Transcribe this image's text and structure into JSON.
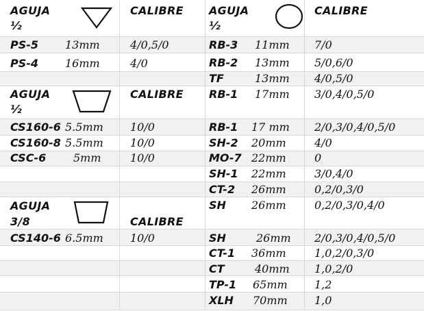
{
  "colors": {
    "band": "#f1f1f1",
    "grid": "#d8d8d8",
    "text": "#111111"
  },
  "headers": {
    "left_top": {
      "aguja": "AGUJA",
      "size": "½",
      "calibre": "CALIBRE",
      "shape_icon": "triangle-icon"
    },
    "right_top": {
      "aguja": "AGUJA",
      "size": "½",
      "calibre": "CALIBRE",
      "shape_icon": "circle-icon"
    },
    "left_mid": {
      "aguja": "AGUJA",
      "size": "½",
      "calibre": "CALIBRE",
      "shape_icon": "trapezoid-icon"
    },
    "left_low": {
      "aguja": "AGUJA",
      "size": "3/8",
      "calibre": "CALIBRE",
      "shape_icon": "trapezoid-icon"
    }
  },
  "left_rows": [
    {
      "code": "PS-5",
      "mm": "13mm",
      "calibre": "4/0,5/0"
    },
    {
      "code": "PS-4",
      "mm": "16mm",
      "calibre": "4/0"
    },
    {
      "code": "CS160-6",
      "mm": "5.5mm",
      "calibre": "10/0"
    },
    {
      "code": "CS160-8",
      "mm": "5.5mm",
      "calibre": "10/0"
    },
    {
      "code": "CSC-6",
      "mm": "5mm",
      "calibre": "10/0"
    },
    {
      "code": "CS140-6",
      "mm": "6.5mm",
      "calibre": "10/0"
    }
  ],
  "right_rows": [
    {
      "code": "RB-3",
      "mm": "11mm",
      "calibre": "7/0"
    },
    {
      "code": "RB-2",
      "mm": "13mm",
      "calibre": "5/0,6/0"
    },
    {
      "code": "TF",
      "mm": "13mm",
      "calibre": "4/0,5/0"
    },
    {
      "code": "RB-1",
      "mm": "17mm",
      "calibre": "3/0,4/0,5/0"
    },
    {
      "code": "RB-1",
      "mm": "17 mm",
      "calibre": "2/0,3/0,4/0,5/0"
    },
    {
      "code": "SH-2",
      "mm": "20mm",
      "calibre": "4/0"
    },
    {
      "code": "MO-7",
      "mm": "22mm",
      "calibre": "0"
    },
    {
      "code": "SH-1",
      "mm": "22mm",
      "calibre": "3/0,4/0"
    },
    {
      "code": "CT-2",
      "mm": "26mm",
      "calibre": "0,2/0,3/0"
    },
    {
      "code": "SH",
      "mm": "26mm",
      "calibre": "0,2/0,3/0,4/0"
    },
    {
      "code": "SH",
      "mm": "26mm",
      "calibre": "2/0,3/0,4/0,5/0"
    },
    {
      "code": "CT-1",
      "mm": "36mm",
      "calibre": "1,0,2/0,3/0"
    },
    {
      "code": "CT",
      "mm": "40mm",
      "calibre": "1,0,2/0"
    },
    {
      "code": "TP-1",
      "mm": "65mm",
      "calibre": "1,2"
    },
    {
      "code": "XLH",
      "mm": "70mm",
      "calibre": "1,0"
    }
  ]
}
